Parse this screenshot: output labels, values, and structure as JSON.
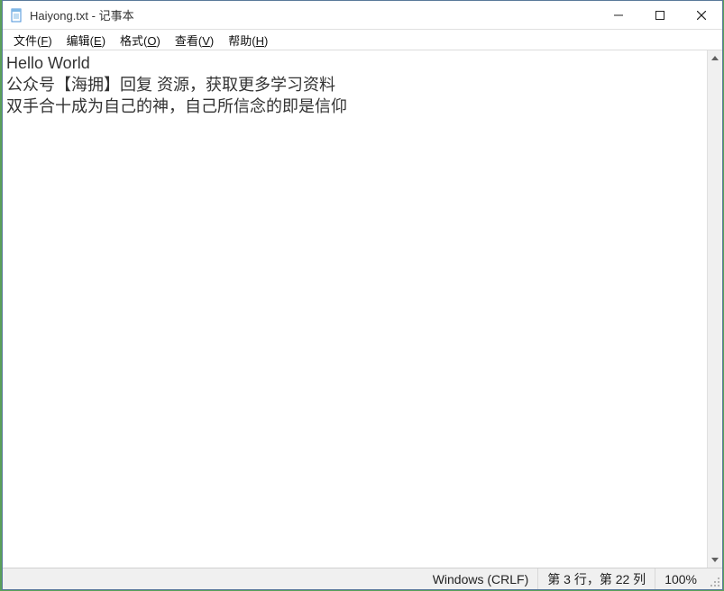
{
  "titlebar": {
    "title": "Haiyong.txt - 记事本"
  },
  "menu": {
    "file": {
      "label": "文件",
      "accel": "F"
    },
    "edit": {
      "label": "编辑",
      "accel": "E"
    },
    "format": {
      "label": "格式",
      "accel": "O"
    },
    "view": {
      "label": "查看",
      "accel": "V"
    },
    "help": {
      "label": "帮助",
      "accel": "H"
    }
  },
  "editor": {
    "content": "Hello World\n公众号【海拥】回复 资源，获取更多学习资料\n双手合十成为自己的神，自己所信念的即是信仰"
  },
  "statusbar": {
    "encoding": "Windows (CRLF)",
    "position": "第 3 行，第 22 列",
    "zoom": "100%"
  }
}
